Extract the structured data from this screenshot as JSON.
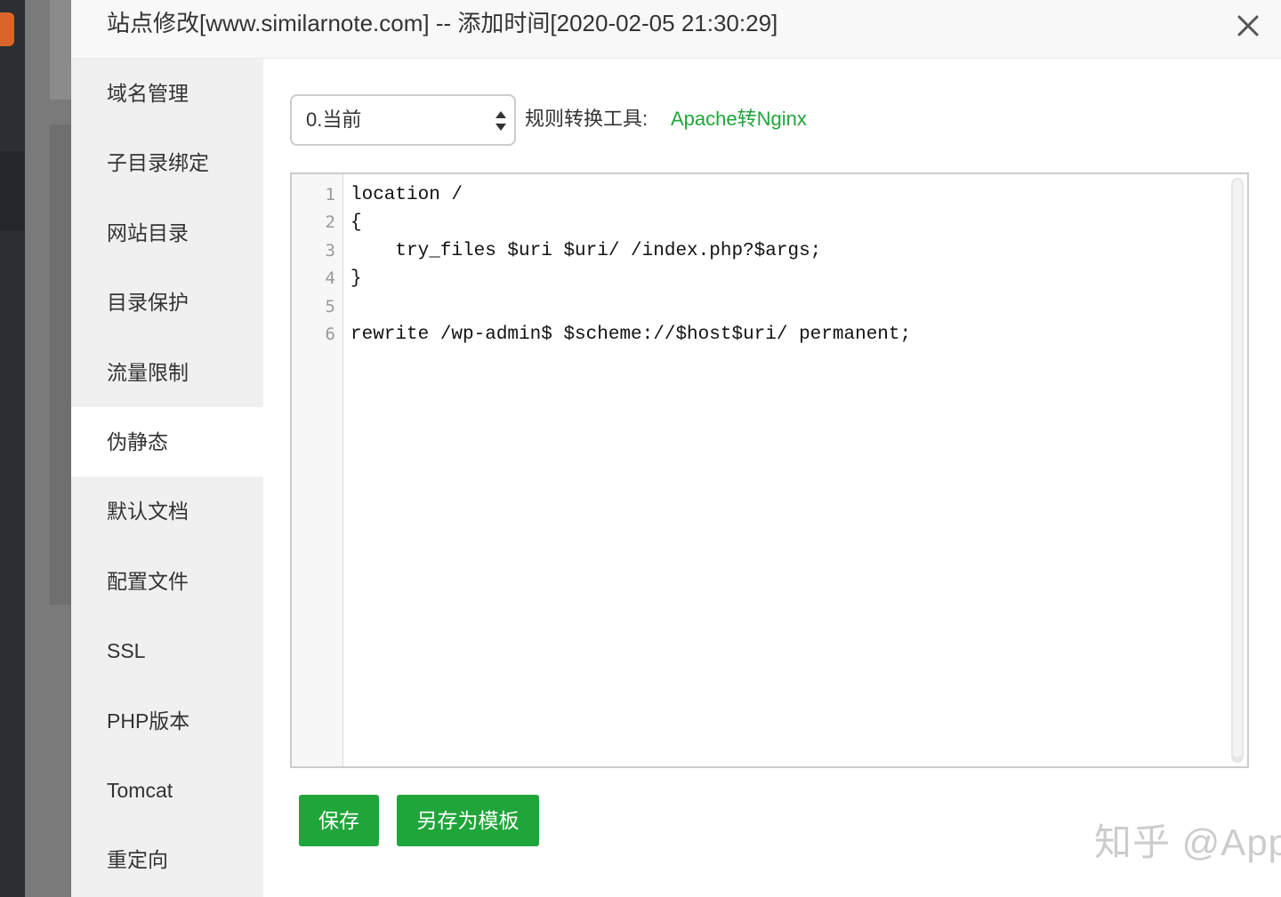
{
  "modal": {
    "title": "站点修改[www.similarnote.com] -- 添加时间[2020-02-05 21:30:29]"
  },
  "sidebar": {
    "items": [
      {
        "label": "域名管理"
      },
      {
        "label": "子目录绑定"
      },
      {
        "label": "网站目录"
      },
      {
        "label": "目录保护"
      },
      {
        "label": "流量限制"
      },
      {
        "label": "伪静态",
        "active": true
      },
      {
        "label": "默认文档"
      },
      {
        "label": "配置文件"
      },
      {
        "label": "SSL"
      },
      {
        "label": "PHP版本"
      },
      {
        "label": "Tomcat"
      },
      {
        "label": "重定向"
      }
    ]
  },
  "rewrite": {
    "select_value": "0.当前",
    "tool_label": "规则转换工具:",
    "tool_link": "Apache转Nginx"
  },
  "editor": {
    "line_numbers": [
      "1",
      "2",
      "3",
      "4",
      "5",
      "6"
    ],
    "lines": [
      "location /",
      "{",
      "    try_files $uri $uri/ /index.php?$args;",
      "}",
      "",
      "rewrite /wp-admin$ $scheme://$host$uri/ permanent;"
    ]
  },
  "buttons": {
    "save": "保存",
    "save_template": "另存为模板"
  },
  "watermark": "知乎 @Apple",
  "colors": {
    "accent": "#20a53a",
    "sidebar_bg": "#f0f0f0",
    "header_bg": "#f8f8f8"
  }
}
